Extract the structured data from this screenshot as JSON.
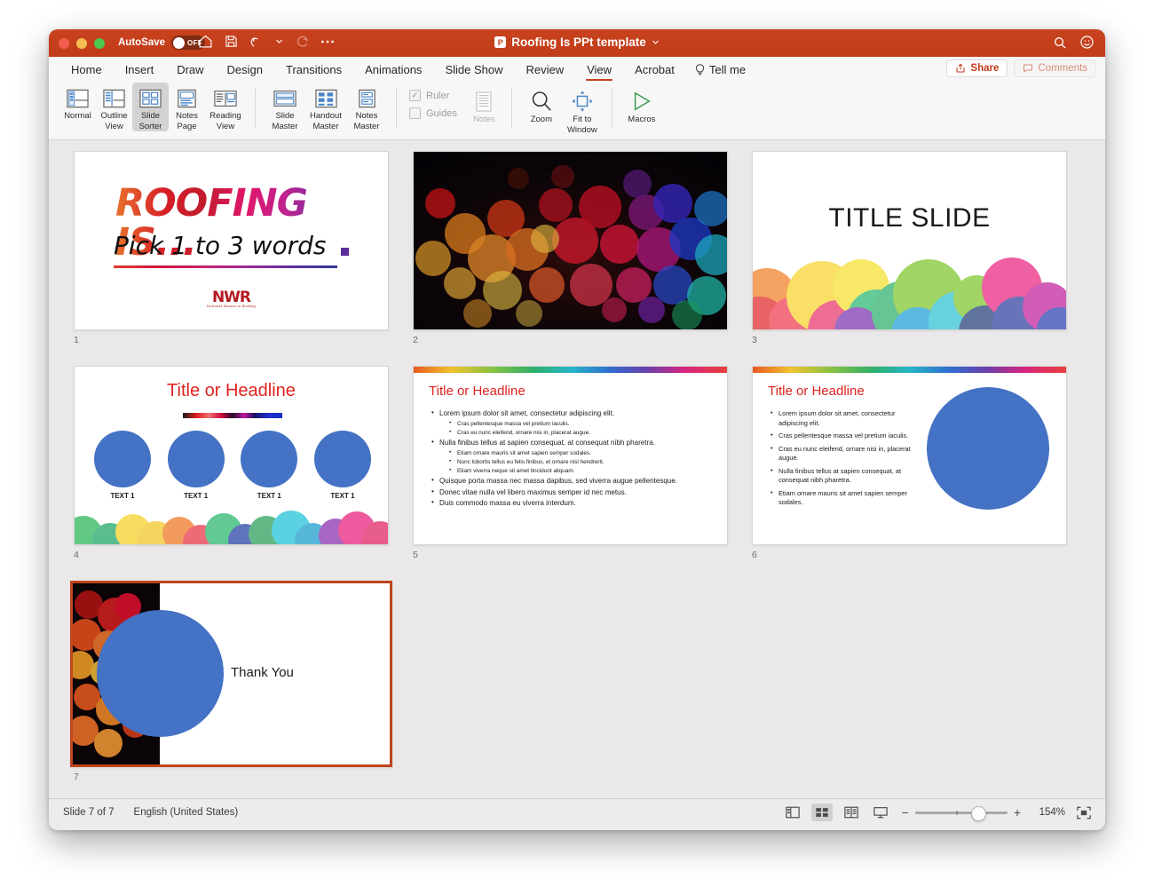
{
  "titlebar": {
    "autosave_label": "AutoSave",
    "autosave_state": "OFF",
    "document_title": "Roofing Is PPt template",
    "icons": [
      "home-icon",
      "save-icon",
      "undo-icon",
      "undo-dropdown-icon",
      "redo-icon",
      "more-icon"
    ],
    "right_icons": [
      "search-icon",
      "smiley-icon"
    ],
    "accent_color": "#c7401c"
  },
  "ribbon_tabs": {
    "items": [
      {
        "label": "Home",
        "active": false
      },
      {
        "label": "Insert",
        "active": false
      },
      {
        "label": "Draw",
        "active": false
      },
      {
        "label": "Design",
        "active": false
      },
      {
        "label": "Transitions",
        "active": false
      },
      {
        "label": "Animations",
        "active": false
      },
      {
        "label": "Slide Show",
        "active": false
      },
      {
        "label": "Review",
        "active": false
      },
      {
        "label": "View",
        "active": true
      },
      {
        "label": "Acrobat",
        "active": false
      }
    ],
    "tell_me": "Tell me",
    "share": "Share",
    "comments": "Comments"
  },
  "ribbon": {
    "presentation_views": [
      {
        "label_line1": "Normal",
        "label_line2": "",
        "icon": "normal-view-icon",
        "selected": false
      },
      {
        "label_line1": "Outline",
        "label_line2": "View",
        "icon": "outline-view-icon",
        "selected": false
      },
      {
        "label_line1": "Slide",
        "label_line2": "Sorter",
        "icon": "slide-sorter-icon",
        "selected": true
      },
      {
        "label_line1": "Notes",
        "label_line2": "Page",
        "icon": "notes-page-icon",
        "selected": false
      },
      {
        "label_line1": "Reading",
        "label_line2": "View",
        "icon": "reading-view-icon",
        "selected": false
      }
    ],
    "master_views": [
      {
        "label_line1": "Slide",
        "label_line2": "Master",
        "icon": "slide-master-icon"
      },
      {
        "label_line1": "Handout",
        "label_line2": "Master",
        "icon": "handout-master-icon"
      },
      {
        "label_line1": "Notes",
        "label_line2": "Master",
        "icon": "notes-master-icon"
      }
    ],
    "show_checks": [
      {
        "label": "Ruler",
        "checked": true
      },
      {
        "label": "Guides",
        "checked": false
      }
    ],
    "notes_label": "Notes",
    "zoom_label": "Zoom",
    "fit_label_line1": "Fit to",
    "fit_label_line2": "Window",
    "macros_label": "Macros"
  },
  "slides": [
    {
      "number": "1",
      "type": "title-cover",
      "title": "ROOFING IS...",
      "subtitle": "Pick 1 to 3 words",
      "logo_main": "NWR",
      "logo_sub": "National Women in Roofing",
      "selected": false
    },
    {
      "number": "2",
      "type": "bokeh-image",
      "selected": false
    },
    {
      "number": "3",
      "type": "title-slide",
      "title": "TITLE SLIDE",
      "selected": false
    },
    {
      "number": "4",
      "type": "four-circles",
      "title": "Title or Headline",
      "circle_labels": [
        "TEXT 1",
        "TEXT 1",
        "TEXT 1",
        "TEXT 1"
      ],
      "selected": false
    },
    {
      "number": "5",
      "type": "bullets-full",
      "title": "Title or Headline",
      "bullets": [
        {
          "level": 1,
          "text": "Lorem ipsum dolor sit amet, consectetur adipiscing elit."
        },
        {
          "level": 2,
          "text": "Cras pellentesque massa vel pretium iaculis."
        },
        {
          "level": 2,
          "text": "Cras eu nunc eleifend, ornare nisi in, placerat augue."
        },
        {
          "level": 1,
          "text": "Nulla finibus tellus at sapien consequat, at consequat nibh pharetra."
        },
        {
          "level": 2,
          "text": "Etiam ornare mauris sit amet sapien semper sodales."
        },
        {
          "level": 2,
          "text": "Nunc lobortis tellus eu felis finibus, et ornare nisl hendrerit."
        },
        {
          "level": 2,
          "text": "Etiam viverra neque sit amet tincidunt aliquam."
        },
        {
          "level": 1,
          "text": "Quisque porta massa nec massa dapibus, sed viverra augue pellentesque."
        },
        {
          "level": 1,
          "text": "Donec vitae nulla vel libero maximus semper id nec metus."
        },
        {
          "level": 1,
          "text": "Duis commodo massa eu viverra interdum."
        }
      ],
      "selected": false
    },
    {
      "number": "6",
      "type": "bullets-circle",
      "title": "Title or Headline",
      "bullets": [
        "Lorem ipsum dolor sit amet, consectetur adipiscing elit.",
        "Cras pellentesque massa vel pretium iaculis.",
        "Cras eu nunc eleifend, ornare nisi in, placerat augue.",
        "Nulla finibus tellus at sapien consequat, at consequat nibh pharetra.",
        "Etiam ornare mauris sit amet sapien semper sodales."
      ],
      "selected": false
    },
    {
      "number": "7",
      "type": "thank-you",
      "text": "Thank You",
      "selected": true
    }
  ],
  "status": {
    "slide_counter": "Slide 7 of 7",
    "language": "English (United States)",
    "zoom_level": "154%",
    "view_buttons": [
      {
        "name": "normal-view-button",
        "active": false
      },
      {
        "name": "slide-sorter-view-button",
        "active": true
      },
      {
        "name": "reading-view-button",
        "active": false
      },
      {
        "name": "slideshow-view-button",
        "active": false
      }
    ],
    "zoom_out": "−",
    "zoom_in": "+",
    "fit_button": "fit-slide-to-window-button"
  }
}
